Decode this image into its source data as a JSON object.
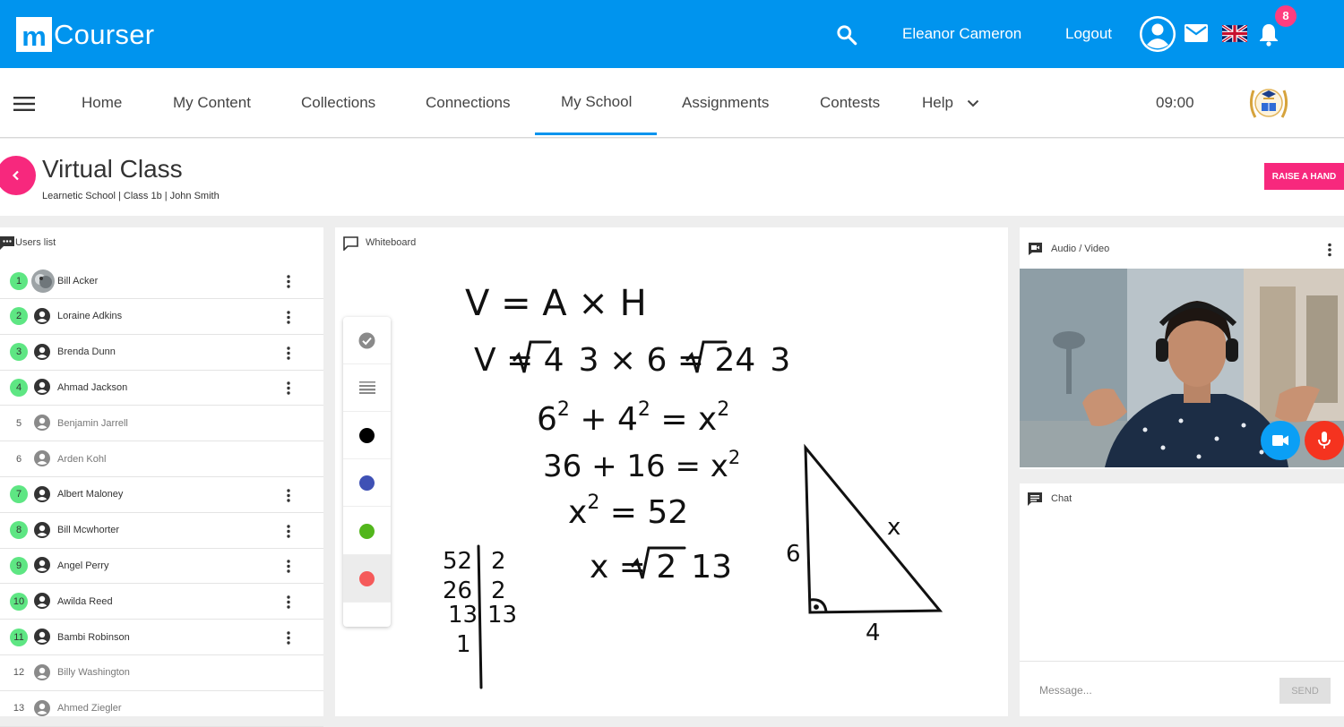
{
  "topbar": {
    "logo_mark": "m",
    "logo_text": "Courser",
    "user_name": "Eleanor Cameron",
    "logout_label": "Logout",
    "notification_count": "8",
    "icons": [
      "search-icon",
      "user-avatar-icon",
      "mail-icon",
      "uk-flag-icon",
      "bell-icon"
    ],
    "brand_color": "#0094ee"
  },
  "nav": {
    "items": [
      "Home",
      "My Content",
      "Collections",
      "Connections",
      "My School",
      "Assignments",
      "Contests",
      "Help"
    ],
    "active": "My School",
    "time": "09:00"
  },
  "page": {
    "title": "Virtual Class",
    "breadcrumb": "Learnetic School | Class 1b | John Smith",
    "raise_hand_label": "RAISE A HAND",
    "accent_color": "#f7287d"
  },
  "users_panel": {
    "title": "Users list",
    "users": [
      {
        "num": "1",
        "name": "Bill Acker",
        "online": true,
        "photo": true
      },
      {
        "num": "2",
        "name": "Loraine Adkins",
        "online": true
      },
      {
        "num": "3",
        "name": "Brenda Dunn",
        "online": true
      },
      {
        "num": "4",
        "name": "Ahmad Jackson",
        "online": true
      },
      {
        "num": "5",
        "name": "Benjamin Jarrell",
        "online": false
      },
      {
        "num": "6",
        "name": "Arden Kohl",
        "online": false
      },
      {
        "num": "7",
        "name": "Albert Maloney",
        "online": true
      },
      {
        "num": "8",
        "name": "Bill Mcwhorter",
        "online": true
      },
      {
        "num": "9",
        "name": "Angel Perry",
        "online": true
      },
      {
        "num": "10",
        "name": "Awilda Reed",
        "online": true
      },
      {
        "num": "11",
        "name": "Bambi Robinson",
        "online": true
      },
      {
        "num": "12",
        "name": "Billy Washington",
        "online": false
      },
      {
        "num": "13",
        "name": "Ahmed Ziegler",
        "online": false
      }
    ]
  },
  "whiteboard": {
    "title": "Whiteboard",
    "tools": [
      "check-icon",
      "line-width-icon",
      "color-black",
      "color-blue",
      "color-green",
      "color-red"
    ],
    "selected_tool": "color-red",
    "colors": {
      "black": "#000000",
      "blue": "#3f51b5",
      "green": "#52b61c",
      "red": "#f55a5a"
    },
    "lines": {
      "l1_lhs": "V = A × H",
      "l2_lhs": "V = 4",
      "l2_root": "3",
      "l2_mid": " × 6 = 24",
      "l2_root2": "3",
      "l3_base1": "6",
      "l3_exp1": "2",
      "l3_plus": " + 4",
      "l3_exp2": "2",
      "l3_eq": " = x",
      "l3_exp3": "2",
      "l4": "36 + 16 = x",
      "l4_exp": "2",
      "l5_x": "x",
      "l5_exp": "2",
      "l5_rest": " = 52",
      "l6_pre": "x = 2",
      "l6_root": "13"
    },
    "factor_left": [
      "52",
      "26",
      "13",
      "1"
    ],
    "factor_right": [
      "2",
      "2",
      "13"
    ],
    "triangle": {
      "side_left": "6",
      "side_bottom": "4",
      "hypotenuse": "x"
    }
  },
  "audio_video": {
    "title": "Audio / Video"
  },
  "chat": {
    "title": "Chat",
    "placeholder": "Message...",
    "send_label": "SEND"
  }
}
